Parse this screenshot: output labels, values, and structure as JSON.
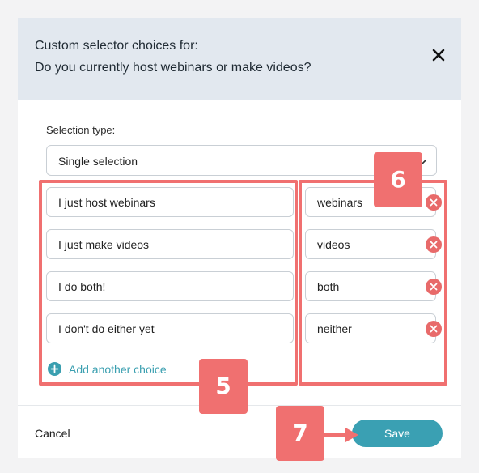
{
  "dialog": {
    "title_line1": "Custom selector choices for:",
    "title_line2": "Do you currently host webinars or make videos?",
    "close_icon": "close-icon"
  },
  "selection_type": {
    "label": "Selection type:",
    "value": "Single selection"
  },
  "choices": [
    {
      "label": "I just host webinars",
      "value": "webinars"
    },
    {
      "label": "I just make videos",
      "value": "videos"
    },
    {
      "label": "I do both!",
      "value": "both"
    },
    {
      "label": "I don't do either yet",
      "value": "neither"
    }
  ],
  "add_choice": {
    "label": "Add another choice",
    "icon": "plus-circle-icon"
  },
  "footer": {
    "cancel_label": "Cancel",
    "save_label": "Save"
  },
  "annotations": {
    "badge_5": "5",
    "badge_6": "6",
    "badge_7": "7",
    "color": "#f07070"
  },
  "colors": {
    "accent": "#3aa0b3",
    "remove": "#e86a6a",
    "header_bg": "#e2e8ef"
  }
}
